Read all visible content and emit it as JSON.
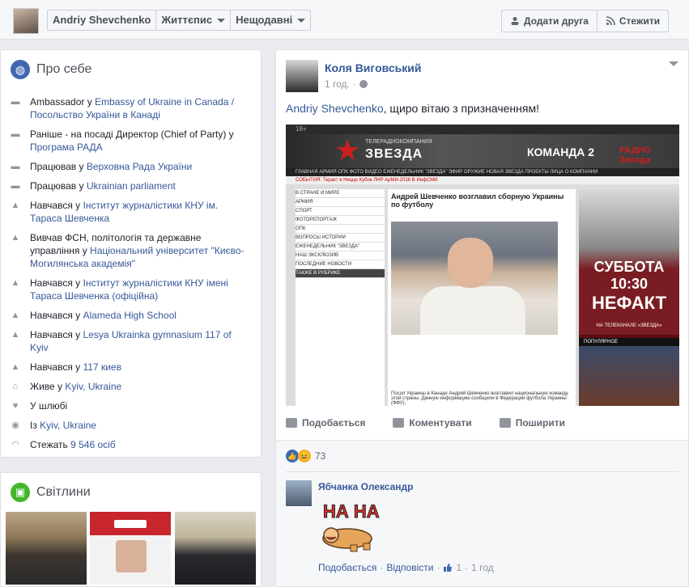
{
  "topbar": {
    "profile_name": "Andriy Shevchenko",
    "timeline_label": "Життєпис",
    "recent_label": "Нещодавні",
    "add_friend_label": "Додати друга",
    "follow_label": "Стежити"
  },
  "about": {
    "title": "Про себе",
    "items": [
      {
        "icon": "briefcase-icon",
        "pre": "Ambassador у ",
        "link": "Embassy of Ukraine in Canada / Посольство України в Канаді"
      },
      {
        "icon": "briefcase-icon",
        "pre": "Раніше - на посаді Директор (Chief of Party) у ",
        "link": "Програма РАДА"
      },
      {
        "icon": "briefcase-icon",
        "pre": "Працював у ",
        "link": "Верховна Рада України"
      },
      {
        "icon": "briefcase-icon",
        "pre": "Працював у ",
        "link": "Ukrainian parliament"
      },
      {
        "icon": "school-icon",
        "pre": "Навчався у ",
        "link": "Інститут журналістики КНУ ім. Тараса Шевченка"
      },
      {
        "icon": "school-icon",
        "pre": "Вивчав ФСН, політологія та державне управління у ",
        "link": "Національний університет \"Києво-Могилянська академія\""
      },
      {
        "icon": "school-icon",
        "pre": "Навчався у ",
        "link": "Інститут журналістики КНУ імені Тараса Шевченка (офіційна)"
      },
      {
        "icon": "school-icon",
        "pre": "Навчався у ",
        "link": "Alameda High School"
      },
      {
        "icon": "school-icon",
        "pre": "Навчався у ",
        "link": "Lesya Ukrainka gymnasium 117 of Kyiv"
      },
      {
        "icon": "school-icon",
        "pre": "Навчався у ",
        "link": "117 киев"
      },
      {
        "icon": "home-icon",
        "pre": "Живе у ",
        "link": "Kyiv, Ukraine"
      },
      {
        "icon": "heart-icon",
        "pre": "У шлюбі",
        "link": ""
      },
      {
        "icon": "location-pin-icon",
        "pre": "Із ",
        "link": "Kyiv, Ukraine"
      },
      {
        "icon": "rss-icon",
        "pre": "Стежать ",
        "link": "9 546 осіб"
      }
    ]
  },
  "photos": {
    "title": "Світлини"
  },
  "post": {
    "author": "Коля Виговський",
    "time": "1 год.",
    "mention": "Andriy Shevchenko",
    "text": ", щиро вітаю з призначенням!",
    "shared_image": {
      "channel": "ЗВЕЗДА",
      "channel_sub": "ТЕЛЕРАДИОКОМПАНИЯ",
      "team": "КОМАНДА 2",
      "radio": "РАДИО Звезда",
      "nav": "ГЛАВНАЯ   АРМИЯ   ОПК   ФОТО   ВИДЕО   ЕЖЕНЕДЕЛЬНИК \"ЗВЕЗДА\"   ЭФИР   ОРУЖИЕ   НОВАЯ ЗВЕЗДА   ПРОЕКТЫ   ЛИЦА   О КОМПАНИИ",
      "events": "СОБЫТИЯ:  Теракт в Ницце   Кубок ЛНР   АрМИ-2016   В ИнфСМИ",
      "left_menu": [
        "В СТРАНЕ И МИРЕ",
        "АРМИЯ",
        "СПОРТ",
        "ФОТОРЕПОРТАЖ",
        "ОПК",
        "ВОПРОСЫ ИСТОРИИ",
        "ЕЖЕНЕДЕЛЬНИК \"ЗВЕЗДА\"",
        "НАШ ЭКСКЛЮЗИВ",
        "ПОСЛЕДНИЕ НОВОСТИ"
      ],
      "rubric": "ТАКЖЕ В РУБРИКЕ",
      "headline": "Андрей Шевченко возглавил сборную Украины по футболу",
      "caption": "Посол Украины в Канаде Андрей Шевченко возглавил национальную команду этой страны. Данную информацию сообщили в Федерации футбола Украины (ФФУ).",
      "tv_day": "СУББОТА 10:30",
      "tv_show": "НЕФАКТ",
      "tv_channel": "НА ТЕЛЕКАНАЛЕ «ЗВЕЗДА»",
      "popular": "ПОПУЛЯРНОЕ"
    },
    "like_label": "Подобається",
    "comment_label": "Коментувати",
    "share_label": "Поширити",
    "reaction_count": "73",
    "comment": {
      "author": "Ябчанка Олександр",
      "sticker_text": "НА НА",
      "like": "Подобається",
      "reply": "Відповісти",
      "likes": "1",
      "time": "1 год"
    }
  }
}
